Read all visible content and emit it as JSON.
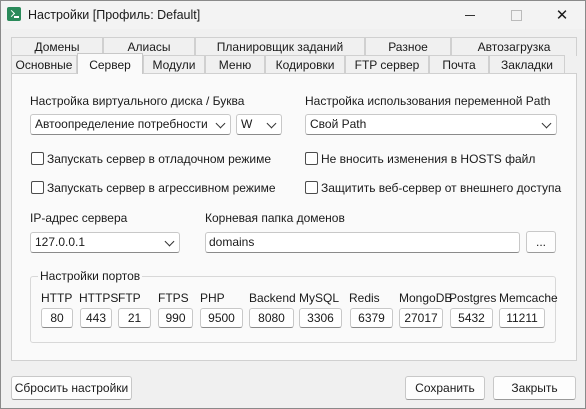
{
  "window": {
    "title": "Настройки [Профиль: Default]",
    "close_glyph": "✕"
  },
  "tabs": {
    "row1": [
      "Домены",
      "Алиасы",
      "Планировщик заданий",
      "Разное",
      "Автозагрузка"
    ],
    "row2": [
      "Основные",
      "Сервер",
      "Модули",
      "Меню",
      "Кодировки",
      "FTP сервер",
      "Почта",
      "Закладки"
    ],
    "active": "Сервер"
  },
  "server": {
    "vdisk_label": "Настройка виртуального диска / Буква",
    "vdisk_value": "Автоопределение потребности",
    "vdisk_letter": "W",
    "path_label": "Настройка использования переменной Path",
    "path_value": "Свой Path",
    "debug_mode": "Запускать сервер в отладочном режиме",
    "aggressive_mode": "Запускать сервер в агрессивном режиме",
    "no_hosts": "Не вносить изменения в HOSTS файл",
    "protect_web": "Защитить веб-сервер от внешнего доступа",
    "ip_label": "IP-адрес сервера",
    "ip_value": "127.0.0.1",
    "root_label": "Корневая папка доменов",
    "root_value": "domains",
    "browse_label": "..."
  },
  "ports": {
    "title": "Настройки портов",
    "items": [
      {
        "name": "HTTP",
        "value": "80"
      },
      {
        "name": "HTTPS",
        "value": "443"
      },
      {
        "name": "FTP",
        "value": "21"
      },
      {
        "name": "FTPS",
        "value": "990"
      },
      {
        "name": "PHP",
        "value": "9500"
      },
      {
        "name": "Backend",
        "value": "8080"
      },
      {
        "name": "MySQL",
        "value": "3306"
      },
      {
        "name": "Redis",
        "value": "6379"
      },
      {
        "name": "MongoDB",
        "value": "27017"
      },
      {
        "name": "Postgres",
        "value": "5432"
      },
      {
        "name": "Memcache",
        "value": "11211"
      }
    ]
  },
  "footer": {
    "reset": "Сбросить настройки",
    "save": "Сохранить",
    "close": "Закрыть"
  }
}
